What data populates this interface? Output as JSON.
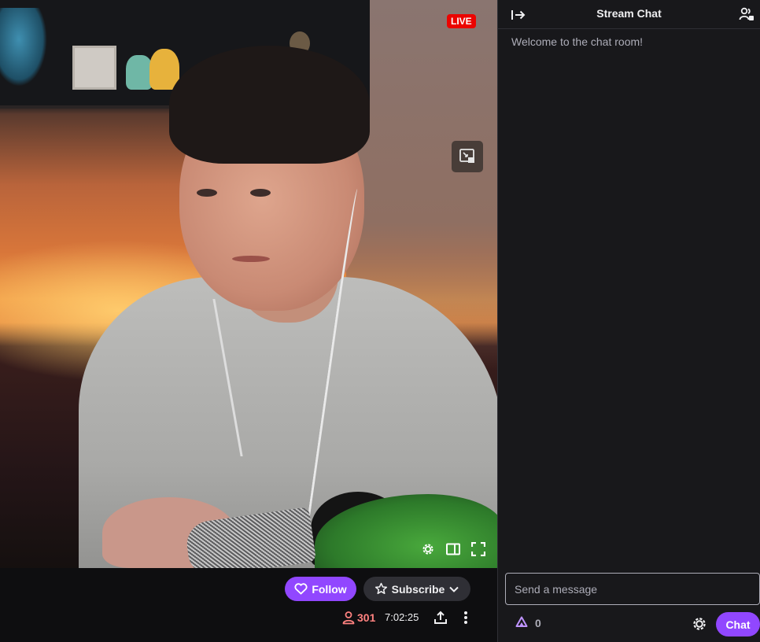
{
  "player": {
    "live_label": "LIVE",
    "controls": [
      "settings-icon",
      "theatre-mode-icon",
      "fullscreen-icon"
    ],
    "overlay_button_icon": "picture-in-picture-icon"
  },
  "channel": {
    "follow_label": "Follow",
    "subscribe_label": "Subscribe",
    "viewer_count": "301",
    "uptime": "7:02:25"
  },
  "chat": {
    "title": "Stream Chat",
    "welcome": "Welcome to the chat room!",
    "input_placeholder": "Send a message",
    "points": "0",
    "send_label": "Chat"
  },
  "colors": {
    "accent": "#9147ff",
    "live": "#eb0400",
    "viewers": "#ff8280",
    "panel": "#18181b",
    "page": "#0e0e10"
  }
}
